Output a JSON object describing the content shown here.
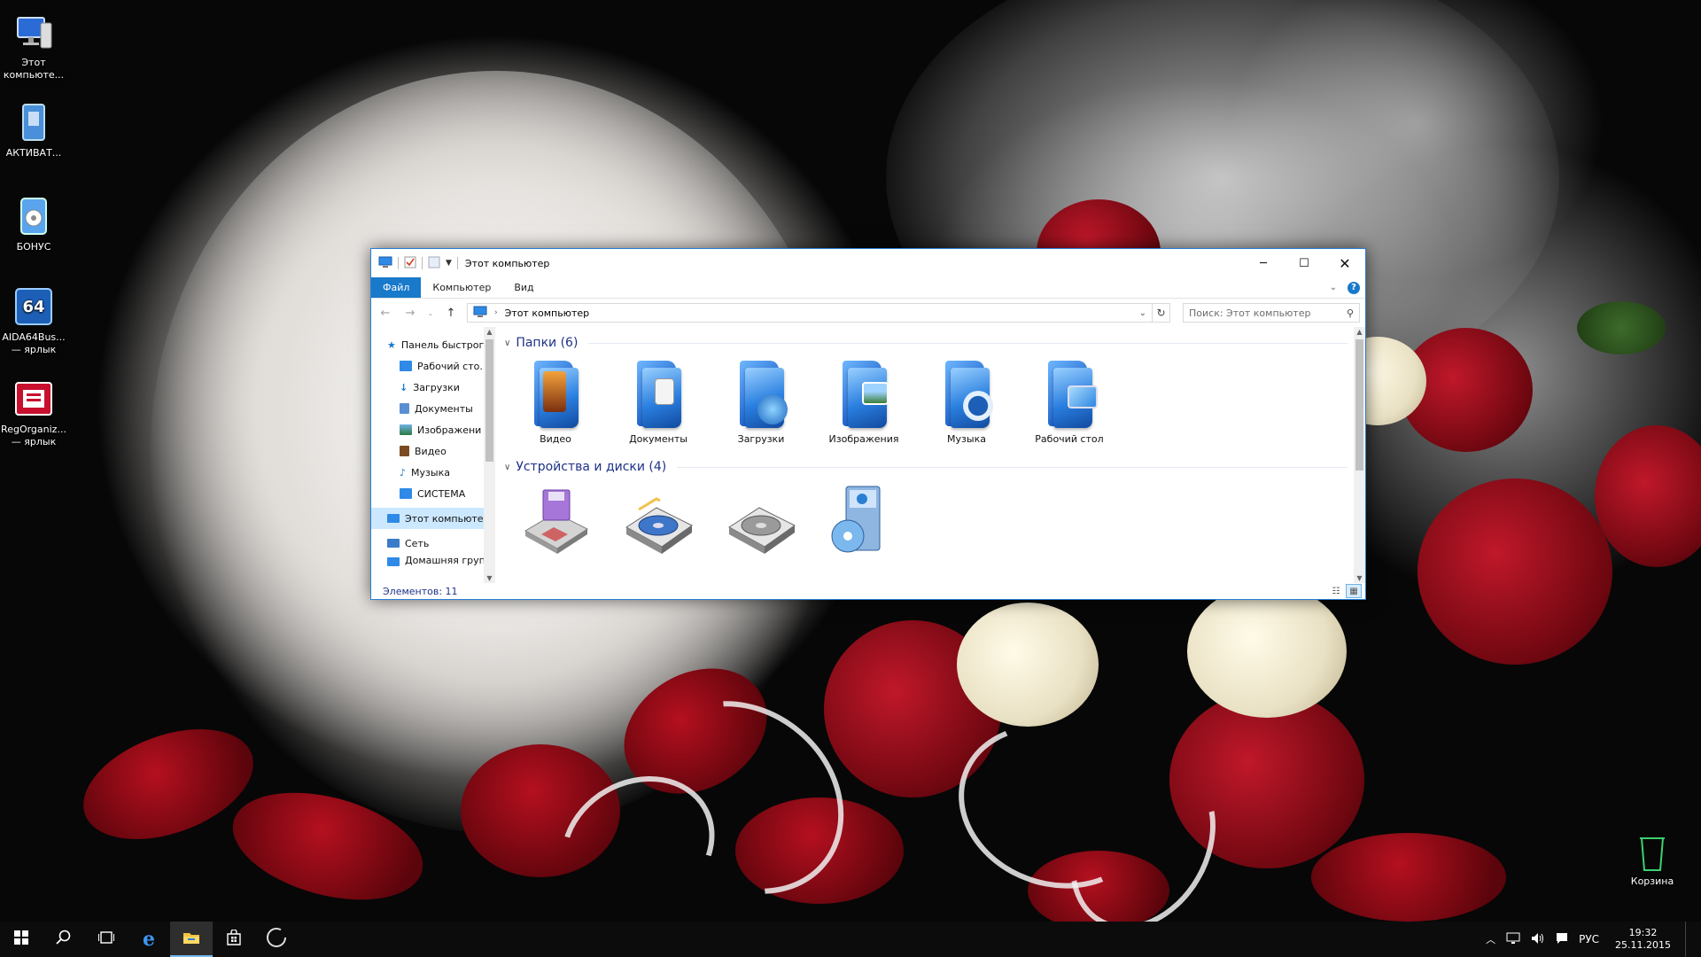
{
  "desktop": {
    "icons": [
      {
        "label": "Этот компьюте..."
      },
      {
        "label": "АКТИВАТ..."
      },
      {
        "label": "БОНУС"
      },
      {
        "label": "AIDA64Bus... — ярлык"
      },
      {
        "label": "RegOrganiz... — ярлык"
      }
    ],
    "recycle_bin": {
      "label": "Корзина"
    }
  },
  "window": {
    "title": "Этот компьютер",
    "tabs": {
      "file": "Файл",
      "computer": "Компьютер",
      "view": "Вид"
    },
    "help": "?",
    "address": "Этот компьютер",
    "search_placeholder": "Поиск: Этот компьютер",
    "nav": {
      "quick_access": "Панель быстрого",
      "desktop": "Рабочий сто.",
      "downloads": "Загрузки",
      "documents": "Документы",
      "pictures": "Изображени",
      "videos": "Видео",
      "music": "Музыка",
      "system": "СИСТЕМА",
      "this_pc": "Этот компьютер",
      "network": "Сеть",
      "homegroup": "Домашняя груп"
    },
    "groups": {
      "folders": "Папки (6)",
      "devices": "Устройства и диски (4)"
    },
    "folders": [
      {
        "label": "Видео"
      },
      {
        "label": "Документы"
      },
      {
        "label": "Загрузки"
      },
      {
        "label": "Изображения"
      },
      {
        "label": "Музыка"
      },
      {
        "label": "Рабочий стол"
      }
    ],
    "status": "Элементов: 11"
  },
  "taskbar": {
    "language": "РУС",
    "time": "19:32",
    "date": "25.11.2015"
  },
  "colors": {
    "accent": "#1979ca",
    "window_border": "#2b7fd3",
    "group_heading": "#1e3287"
  }
}
